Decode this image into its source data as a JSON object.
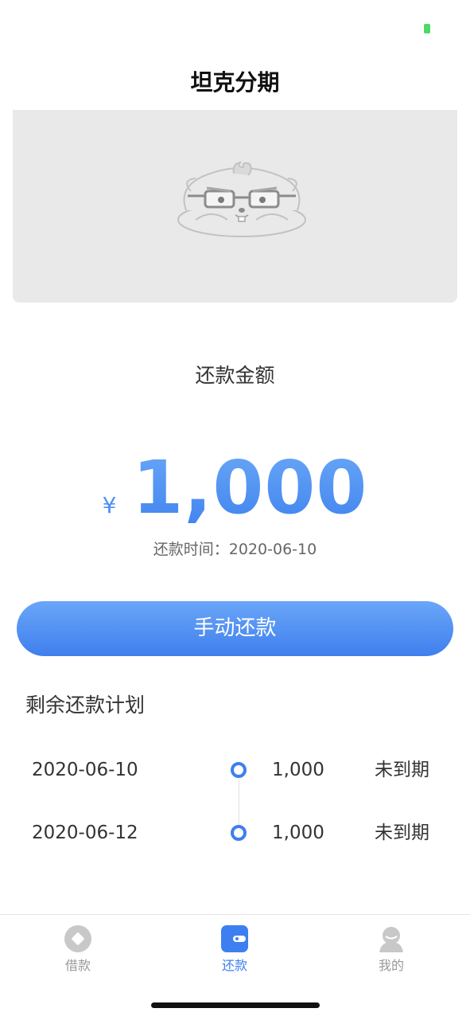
{
  "status_bar": {
    "battery_color": "#4cd964"
  },
  "header": {
    "title": "坦克分期"
  },
  "banner": {
    "image": "mascot-placeholder-icon"
  },
  "repayment": {
    "amount_label": "还款金额",
    "currency_symbol": "¥",
    "amount": "1,000",
    "due_label": "还款时间：",
    "due_date": "2020-06-10",
    "button_label": "手动还款"
  },
  "plan": {
    "title": "剩余还款计划",
    "rows": [
      {
        "date": "2020-06-10",
        "amount": "1,000",
        "status": "未到期"
      },
      {
        "date": "2020-06-12",
        "amount": "1,000",
        "status": "未到期"
      }
    ]
  },
  "tab_bar": {
    "items": [
      {
        "label": "借款",
        "icon": "borrow-icon",
        "active": false
      },
      {
        "label": "还款",
        "icon": "wallet-icon",
        "active": true
      },
      {
        "label": "我的",
        "icon": "profile-icon",
        "active": false
      }
    ]
  },
  "colors": {
    "accent": "#3d7ff0",
    "banner_background": "#e9e9e9",
    "inactive_tab": "#999999"
  }
}
